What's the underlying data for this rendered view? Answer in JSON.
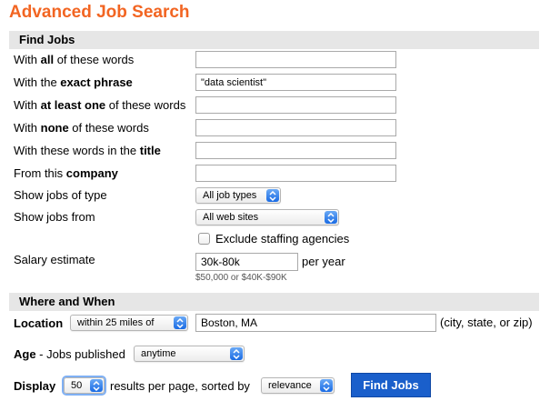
{
  "page": {
    "title": "Advanced Job Search"
  },
  "find_jobs": {
    "header": "Find Jobs",
    "all_words": {
      "pre": "With ",
      "bold": "all",
      "post": " of these words",
      "value": ""
    },
    "exact_phrase": {
      "pre": "With the ",
      "bold": "exact phrase",
      "post": "",
      "value": "\"data scientist\""
    },
    "at_least_one": {
      "pre": "With ",
      "bold": "at least one",
      "post": " of these words",
      "value": ""
    },
    "none_words": {
      "pre": "With ",
      "bold": "none",
      "post": " of these words",
      "value": ""
    },
    "title_words": {
      "pre": "With these words in the ",
      "bold": "title",
      "post": "",
      "value": ""
    },
    "company": {
      "pre": "From this ",
      "bold": "company",
      "post": "",
      "value": ""
    },
    "job_type": {
      "label": "Show jobs of type",
      "selected": "All job types"
    },
    "jobs_from": {
      "label": "Show jobs from",
      "selected": "All web sites"
    },
    "exclude_staffing": {
      "label": "Exclude staffing agencies",
      "checked": false
    },
    "salary": {
      "label": "Salary estimate",
      "value": "30k-80k",
      "suffix": "per year",
      "hint": "$50,000 or $40K-$90K"
    }
  },
  "where_when": {
    "header": "Where and When",
    "location": {
      "label": "Location",
      "radius": "within 25 miles of",
      "value": "Boston, MA",
      "hint": "(city, state, or zip)"
    },
    "age": {
      "label_bold": "Age",
      "label_rest": " - Jobs published",
      "selected": "anytime"
    },
    "display": {
      "label": "Display",
      "per_page": "50",
      "mid_text": "results per page, sorted by",
      "sort": "relevance"
    }
  },
  "buttons": {
    "find_jobs": "Find Jobs"
  },
  "icons": {
    "select_arrows": "chevron-updown-icon"
  },
  "colors": {
    "title": "#f26522",
    "button": "#1a5fcb",
    "section_bg": "#e6e6e6"
  }
}
